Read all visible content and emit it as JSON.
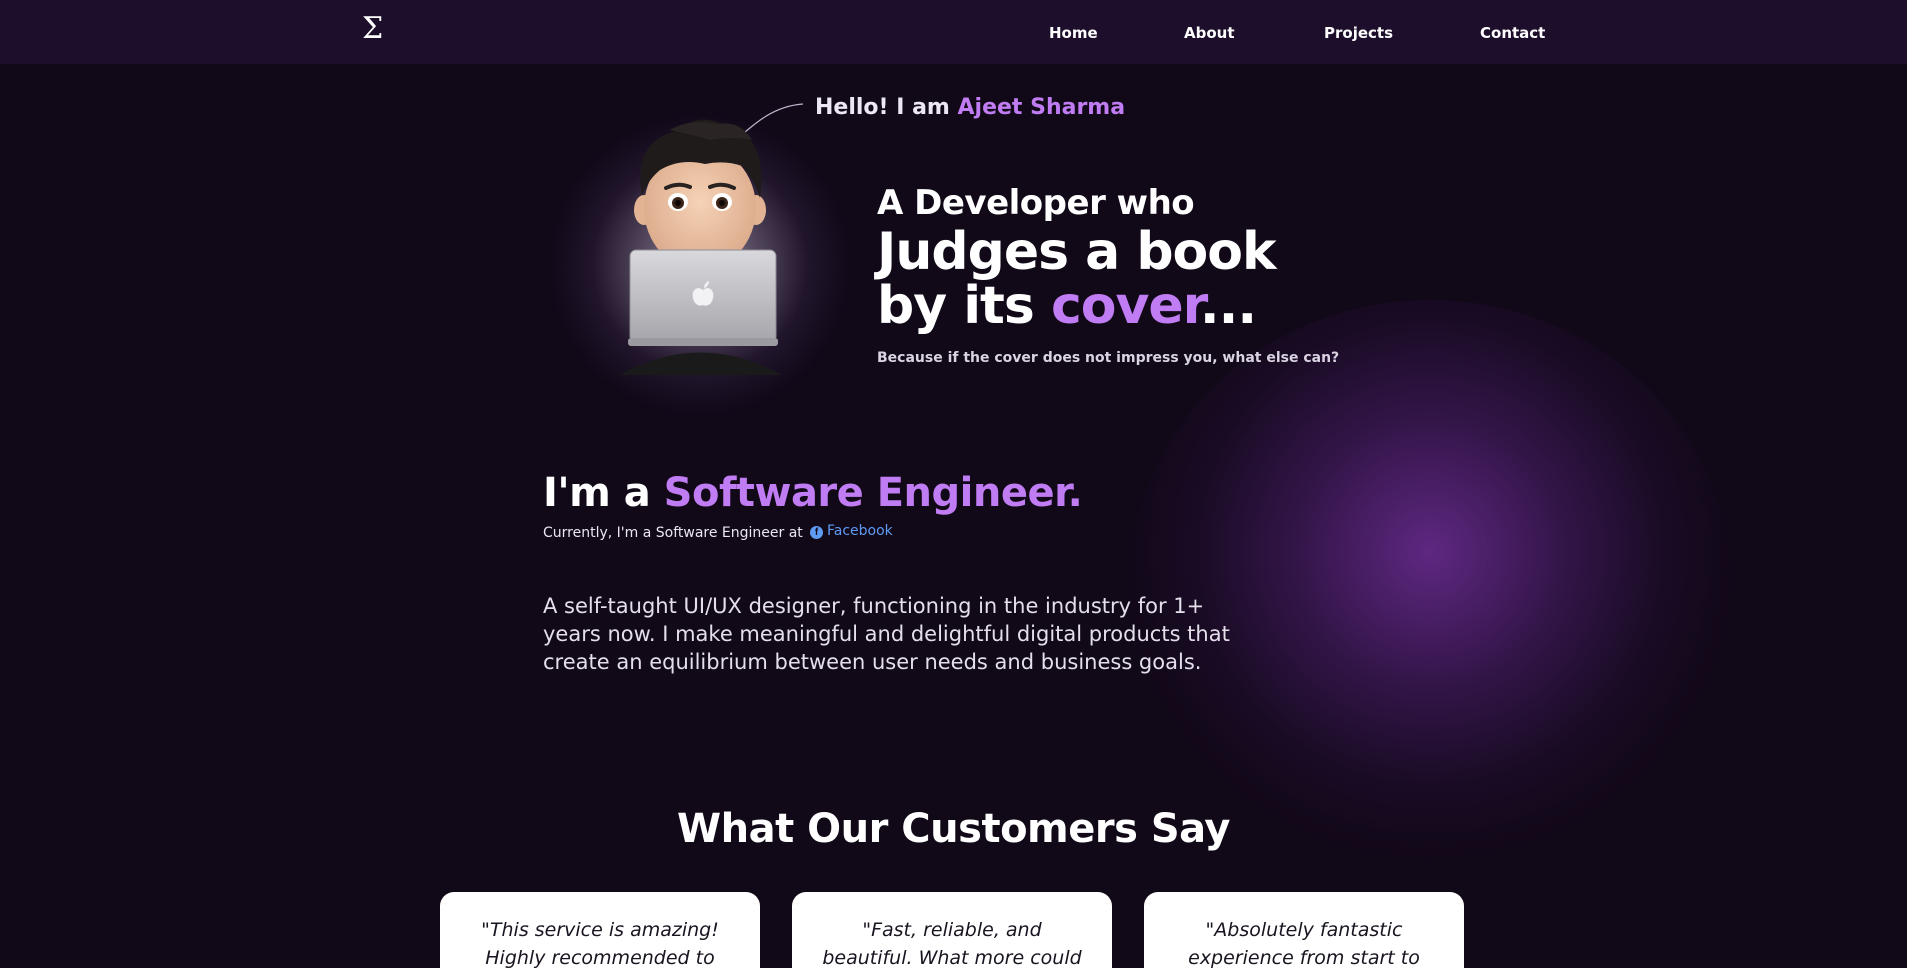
{
  "nav": {
    "logo": "Σ",
    "links": [
      "Home",
      "About",
      "Projects",
      "Contact"
    ]
  },
  "hero": {
    "hello_prefix": "Hello! I am",
    "name": "Ajeet Sharma",
    "line1": "A Developer who",
    "line2": "Judges a book",
    "line3_prefix": "by its",
    "line3_accent": "cover",
    "line3_suffix": "...",
    "subtitle": "Because if the cover does not impress you, what else can?"
  },
  "about": {
    "heading_prefix": "I'm a",
    "heading_accent": "Software Engineer.",
    "current_prefix": "Currently, I'm a Software Engineer at",
    "company": "Facebook",
    "company_icon": "facebook-icon",
    "bio": "A self-taught UI/UX designer, functioning in the industry for 1+ years now. I make meaningful and delightful digital products that create an equilibrium between user needs and business goals."
  },
  "testimonials": {
    "title": "What Our Customers Say",
    "cards": [
      "\"This service is amazing! Highly recommended to",
      "\"Fast, reliable, and beautiful. What more could you want?\"",
      "\"Absolutely fantastic experience from start to"
    ]
  },
  "colors": {
    "background": "#110818",
    "nav": "#1d0e2c",
    "accent": "#c07cf2",
    "link": "#5e9bf5"
  }
}
